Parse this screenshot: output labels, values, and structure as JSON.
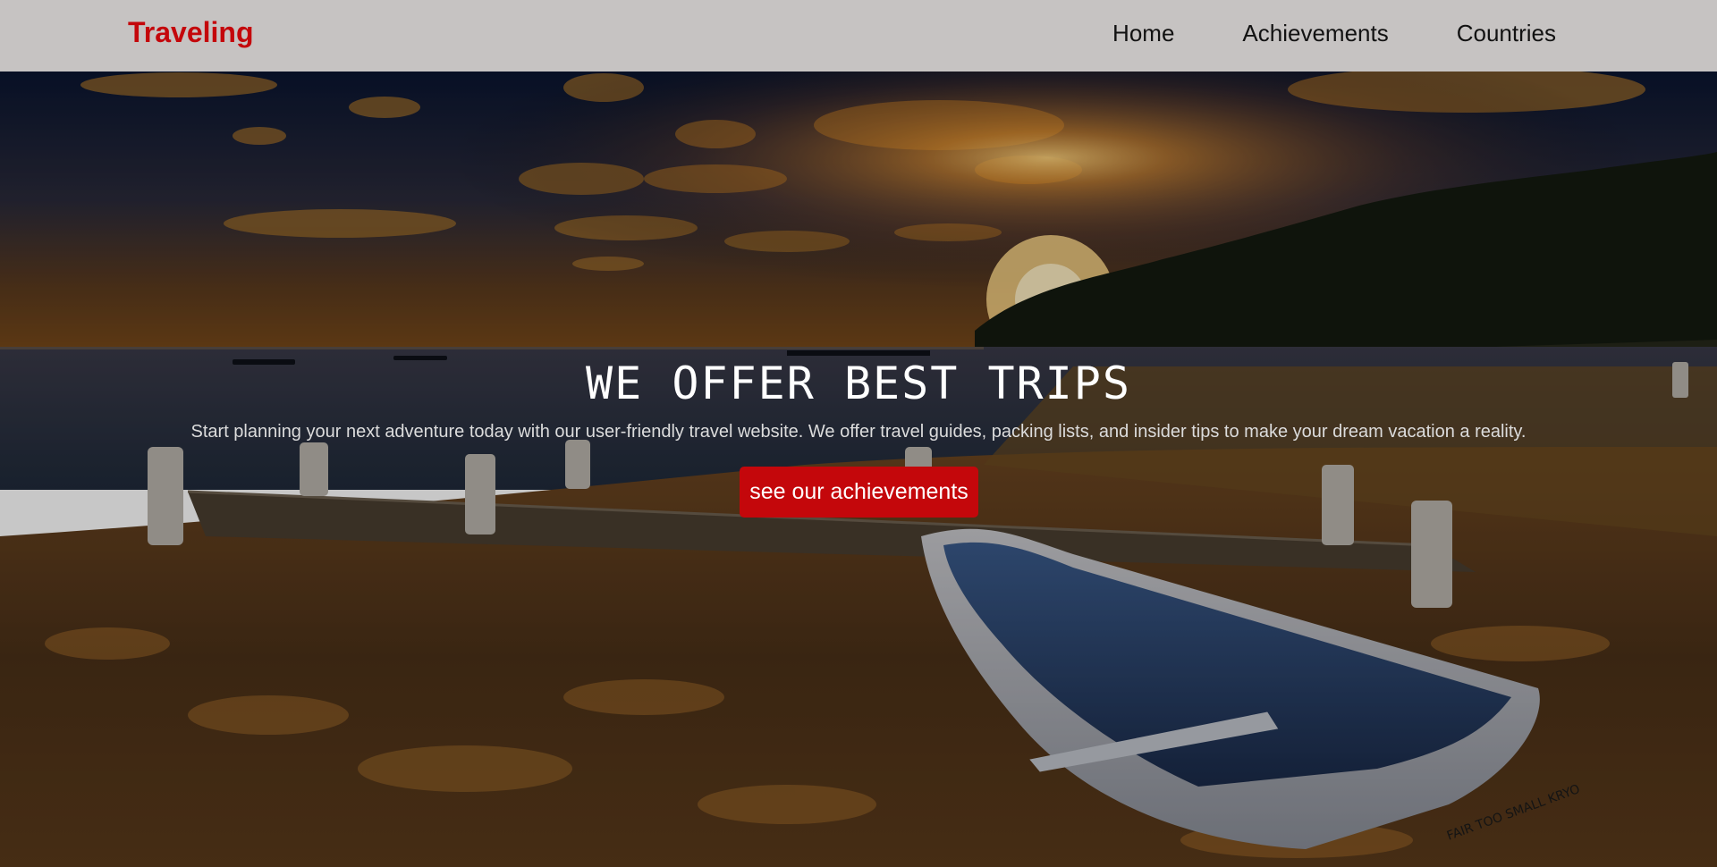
{
  "header": {
    "brand": "Traveling",
    "nav": [
      {
        "label": "Home"
      },
      {
        "label": "Achievements"
      },
      {
        "label": "Countries"
      }
    ]
  },
  "hero": {
    "title": "WE OFFER BEST TRIPS",
    "subtitle": "Start planning your next adventure today with our user-friendly travel website. We offer travel guides, packing lists, and insider tips to make your dream vacation a reality.",
    "cta_label": "see our achievements",
    "boat_text": "FAIR TOO SMALL KRYO"
  },
  "colors": {
    "navbar_bg": "#c6c3c2",
    "brand": "#c4070b",
    "cta_bg": "#c4070b"
  }
}
